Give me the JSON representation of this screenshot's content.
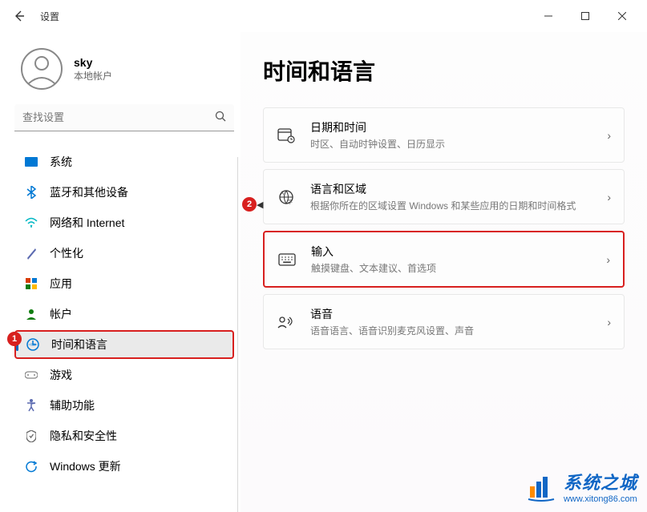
{
  "titlebar": {
    "title": "设置"
  },
  "user": {
    "name": "sky",
    "subtitle": "本地帐户"
  },
  "search": {
    "placeholder": "查找设置"
  },
  "nav": {
    "items": [
      {
        "label": "系统",
        "icon": "system"
      },
      {
        "label": "蓝牙和其他设备",
        "icon": "bluetooth"
      },
      {
        "label": "网络和 Internet",
        "icon": "network"
      },
      {
        "label": "个性化",
        "icon": "personalize"
      },
      {
        "label": "应用",
        "icon": "apps"
      },
      {
        "label": "帐户",
        "icon": "account"
      },
      {
        "label": "时间和语言",
        "icon": "time-lang",
        "selected": true,
        "highlighted": true
      },
      {
        "label": "游戏",
        "icon": "gaming"
      },
      {
        "label": "辅助功能",
        "icon": "accessibility"
      },
      {
        "label": "隐私和安全性",
        "icon": "privacy"
      },
      {
        "label": "Windows 更新",
        "icon": "update"
      }
    ]
  },
  "page": {
    "title": "时间和语言"
  },
  "cards": [
    {
      "title": "日期和时间",
      "subtitle": "时区、自动时钟设置、日历显示",
      "icon": "date"
    },
    {
      "title": "语言和区域",
      "subtitle": "根据你所在的区域设置 Windows 和某些应用的日期和时间格式",
      "icon": "region"
    },
    {
      "title": "输入",
      "subtitle": "触摸键盘、文本建议、首选项",
      "icon": "keyboard",
      "highlighted": true
    },
    {
      "title": "语音",
      "subtitle": "语音语言、语音识别麦克风设置、声音",
      "icon": "speech"
    }
  ],
  "badges": {
    "b1": "1",
    "b2": "2"
  },
  "watermark": {
    "title": "系统之城",
    "url": "www.xitong86.com"
  }
}
